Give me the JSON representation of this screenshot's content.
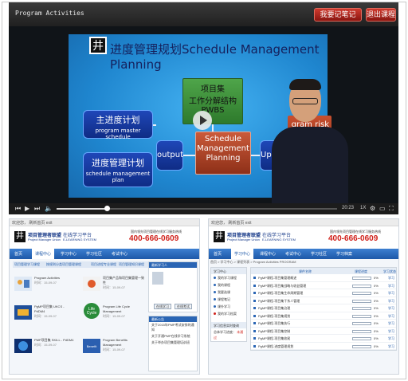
{
  "player": {
    "title": "Program Activities",
    "note_button": "我要记笔记",
    "exit_button": "退出课程",
    "slide": {
      "title": "进度管理规划Schedule Management Planning",
      "logo_glyph": "井",
      "pwbs_line1": "项目集",
      "pwbs_line2": "工作分解结构",
      "pwbs_line3": "PWBS",
      "master_cn": "主进度计划",
      "master_en": "program master schedule",
      "plan_cn": "进度管理计划",
      "plan_en": "schedule management plan",
      "output": "output",
      "center_line1": "Schedule",
      "center_line2": "Management",
      "center_line3": "Planning",
      "update": "Update",
      "risk_line1": "gram risk",
      "risk_line2": "ister"
    },
    "controls": {
      "time": "20:23",
      "speed": "1X",
      "progress": 0.18
    }
  },
  "left_shot": {
    "topbar_text": "欢迎您，    刷新首页    exit",
    "brand_name": "项目管理者联盟",
    "brand_sub": "Project Manager Union",
    "system_name": "在线学习平台",
    "system_sub": "E-LEARNING SYSTEM",
    "hotline_label": "国内领先项目管理在线学习服务热线",
    "hotline": "400-666-0609",
    "nav": [
      "首页",
      "课程中心",
      "学习中心",
      "学习社区",
      "考试中心"
    ],
    "tabs": [
      "项目管理学习课程",
      "按规则分类项目管理课程",
      "项目进程专业课程",
      "项目管理知识课程"
    ],
    "courses": [
      {
        "title": "Program Activities",
        "meta": "时间：15-09-07"
      },
      {
        "title": "项目集产品和项目集管理一致性",
        "meta": "时间：15-09-07"
      },
      {
        "title": "PgMP项目集 UKCS -PdDM4",
        "meta": "时间：15-09-07"
      },
      {
        "title": "Program Life Cycle Management",
        "meta": "时间：15-09-07"
      },
      {
        "title": "PMP项目集 SKILL - PdDM4",
        "meta": "时间：15-09-07"
      },
      {
        "title": "Program Benefits Management",
        "meta": "时间：15-09-07"
      }
    ],
    "side_user": "最新学习人",
    "side_btn1": "在线学习",
    "side_btn2": "在线考试",
    "side_notice_title": "最新公告",
    "side_notices": [
      "关于2015年PMP考试安排的通知",
      "关于开通PMP在线学习系统",
      "关于举办项目集管理培训班"
    ]
  },
  "right_shot": {
    "topbar_text": "欢迎您，    刷新首页    exit",
    "brand_name": "项目管理者联盟",
    "brand_sub": "Project Manager Union",
    "system_name": "在线学习平台",
    "system_sub": "E-LEARNING SYSTEM",
    "hotline_label": "国内领先项目管理在线学习服务热线",
    "hotline": "400-666-0609",
    "nav": [
      "首页",
      "学习中心",
      "课程中心",
      "考试中心",
      "学习社区",
      "学习档案"
    ],
    "crumb": "首页 > 学习中心 > 课程列表 > Program Activities PROGRAM",
    "panel_title": "学习中心",
    "panel_items": [
      "我的学习课程",
      "我的课程",
      "我要选课",
      "课程笔记",
      "课外学习",
      "我的学习档案"
    ],
    "panel2_title": "学习信息实时查询",
    "panel2_item": "总体学习进度：",
    "panel2_value": "未通过",
    "list_headers": [
      "课件名称",
      "课程进度",
      "学习状态"
    ],
    "rows": [
      {
        "name": "PgMP课程-项目集管理概述",
        "pct": "0%",
        "status": "学习"
      },
      {
        "name": "PgMP课程-项目集战略与收益管理",
        "pct": "0%",
        "status": "学习"
      },
      {
        "name": "PgMP课程-项目集生命周期管理",
        "pct": "0%",
        "status": "学习"
      },
      {
        "name": "PgMP课程-项目集干系人管理",
        "pct": "0%",
        "status": "学习"
      },
      {
        "name": "PgMP课程-项目集治理",
        "pct": "0%",
        "status": "学习"
      },
      {
        "name": "PgMP课程-项目集规划",
        "pct": "0%",
        "status": "学习"
      },
      {
        "name": "PgMP课程-项目集执行",
        "pct": "0%",
        "status": "学习"
      },
      {
        "name": "PgMP课程-项目集控制",
        "pct": "0%",
        "status": "学习"
      },
      {
        "name": "PgMP课程-项目集收尾",
        "pct": "0%",
        "status": "学习"
      },
      {
        "name": "PgMP课程-进度管理规划",
        "pct": "0%",
        "status": "学习"
      }
    ]
  }
}
